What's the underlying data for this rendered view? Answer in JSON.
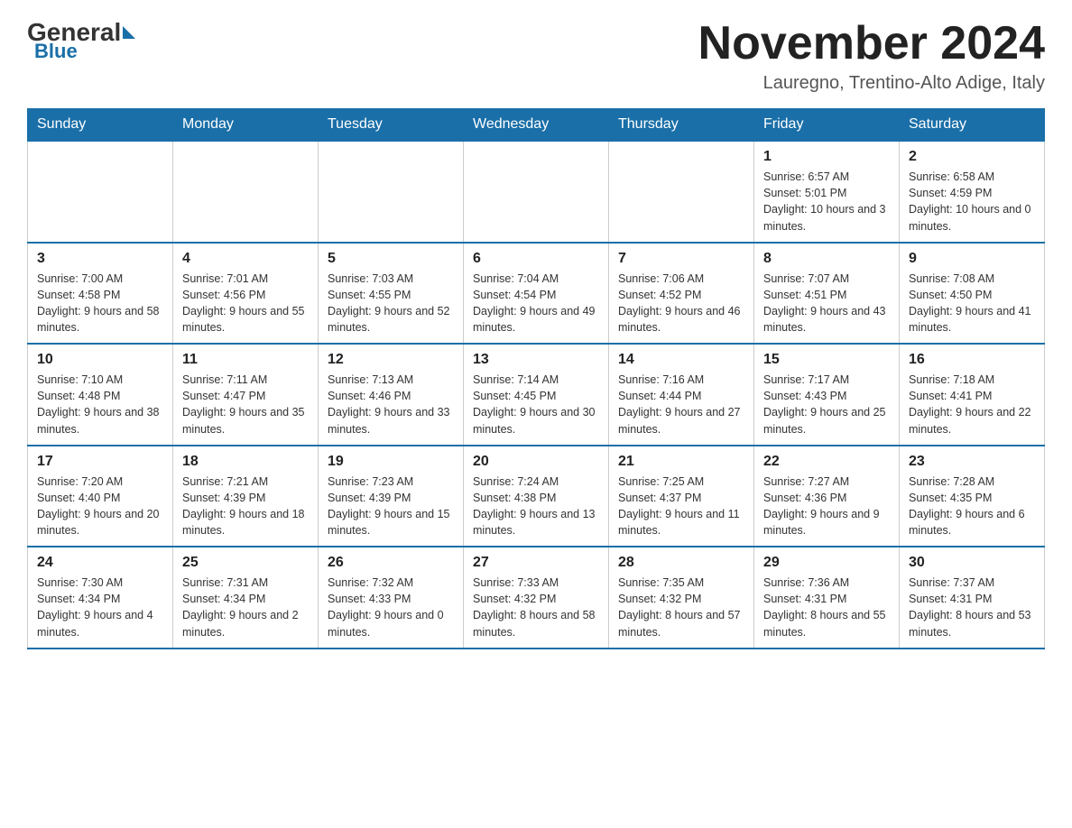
{
  "header": {
    "logo_general": "General",
    "logo_blue": "Blue",
    "month_title": "November 2024",
    "subtitle": "Lauregno, Trentino-Alto Adige, Italy"
  },
  "days_of_week": [
    "Sunday",
    "Monday",
    "Tuesday",
    "Wednesday",
    "Thursday",
    "Friday",
    "Saturday"
  ],
  "weeks": [
    {
      "days": [
        {
          "number": "",
          "info": ""
        },
        {
          "number": "",
          "info": ""
        },
        {
          "number": "",
          "info": ""
        },
        {
          "number": "",
          "info": ""
        },
        {
          "number": "",
          "info": ""
        },
        {
          "number": "1",
          "info": "Sunrise: 6:57 AM\nSunset: 5:01 PM\nDaylight: 10 hours and 3 minutes."
        },
        {
          "number": "2",
          "info": "Sunrise: 6:58 AM\nSunset: 4:59 PM\nDaylight: 10 hours and 0 minutes."
        }
      ]
    },
    {
      "days": [
        {
          "number": "3",
          "info": "Sunrise: 7:00 AM\nSunset: 4:58 PM\nDaylight: 9 hours and 58 minutes."
        },
        {
          "number": "4",
          "info": "Sunrise: 7:01 AM\nSunset: 4:56 PM\nDaylight: 9 hours and 55 minutes."
        },
        {
          "number": "5",
          "info": "Sunrise: 7:03 AM\nSunset: 4:55 PM\nDaylight: 9 hours and 52 minutes."
        },
        {
          "number": "6",
          "info": "Sunrise: 7:04 AM\nSunset: 4:54 PM\nDaylight: 9 hours and 49 minutes."
        },
        {
          "number": "7",
          "info": "Sunrise: 7:06 AM\nSunset: 4:52 PM\nDaylight: 9 hours and 46 minutes."
        },
        {
          "number": "8",
          "info": "Sunrise: 7:07 AM\nSunset: 4:51 PM\nDaylight: 9 hours and 43 minutes."
        },
        {
          "number": "9",
          "info": "Sunrise: 7:08 AM\nSunset: 4:50 PM\nDaylight: 9 hours and 41 minutes."
        }
      ]
    },
    {
      "days": [
        {
          "number": "10",
          "info": "Sunrise: 7:10 AM\nSunset: 4:48 PM\nDaylight: 9 hours and 38 minutes."
        },
        {
          "number": "11",
          "info": "Sunrise: 7:11 AM\nSunset: 4:47 PM\nDaylight: 9 hours and 35 minutes."
        },
        {
          "number": "12",
          "info": "Sunrise: 7:13 AM\nSunset: 4:46 PM\nDaylight: 9 hours and 33 minutes."
        },
        {
          "number": "13",
          "info": "Sunrise: 7:14 AM\nSunset: 4:45 PM\nDaylight: 9 hours and 30 minutes."
        },
        {
          "number": "14",
          "info": "Sunrise: 7:16 AM\nSunset: 4:44 PM\nDaylight: 9 hours and 27 minutes."
        },
        {
          "number": "15",
          "info": "Sunrise: 7:17 AM\nSunset: 4:43 PM\nDaylight: 9 hours and 25 minutes."
        },
        {
          "number": "16",
          "info": "Sunrise: 7:18 AM\nSunset: 4:41 PM\nDaylight: 9 hours and 22 minutes."
        }
      ]
    },
    {
      "days": [
        {
          "number": "17",
          "info": "Sunrise: 7:20 AM\nSunset: 4:40 PM\nDaylight: 9 hours and 20 minutes."
        },
        {
          "number": "18",
          "info": "Sunrise: 7:21 AM\nSunset: 4:39 PM\nDaylight: 9 hours and 18 minutes."
        },
        {
          "number": "19",
          "info": "Sunrise: 7:23 AM\nSunset: 4:39 PM\nDaylight: 9 hours and 15 minutes."
        },
        {
          "number": "20",
          "info": "Sunrise: 7:24 AM\nSunset: 4:38 PM\nDaylight: 9 hours and 13 minutes."
        },
        {
          "number": "21",
          "info": "Sunrise: 7:25 AM\nSunset: 4:37 PM\nDaylight: 9 hours and 11 minutes."
        },
        {
          "number": "22",
          "info": "Sunrise: 7:27 AM\nSunset: 4:36 PM\nDaylight: 9 hours and 9 minutes."
        },
        {
          "number": "23",
          "info": "Sunrise: 7:28 AM\nSunset: 4:35 PM\nDaylight: 9 hours and 6 minutes."
        }
      ]
    },
    {
      "days": [
        {
          "number": "24",
          "info": "Sunrise: 7:30 AM\nSunset: 4:34 PM\nDaylight: 9 hours and 4 minutes."
        },
        {
          "number": "25",
          "info": "Sunrise: 7:31 AM\nSunset: 4:34 PM\nDaylight: 9 hours and 2 minutes."
        },
        {
          "number": "26",
          "info": "Sunrise: 7:32 AM\nSunset: 4:33 PM\nDaylight: 9 hours and 0 minutes."
        },
        {
          "number": "27",
          "info": "Sunrise: 7:33 AM\nSunset: 4:32 PM\nDaylight: 8 hours and 58 minutes."
        },
        {
          "number": "28",
          "info": "Sunrise: 7:35 AM\nSunset: 4:32 PM\nDaylight: 8 hours and 57 minutes."
        },
        {
          "number": "29",
          "info": "Sunrise: 7:36 AM\nSunset: 4:31 PM\nDaylight: 8 hours and 55 minutes."
        },
        {
          "number": "30",
          "info": "Sunrise: 7:37 AM\nSunset: 4:31 PM\nDaylight: 8 hours and 53 minutes."
        }
      ]
    }
  ]
}
